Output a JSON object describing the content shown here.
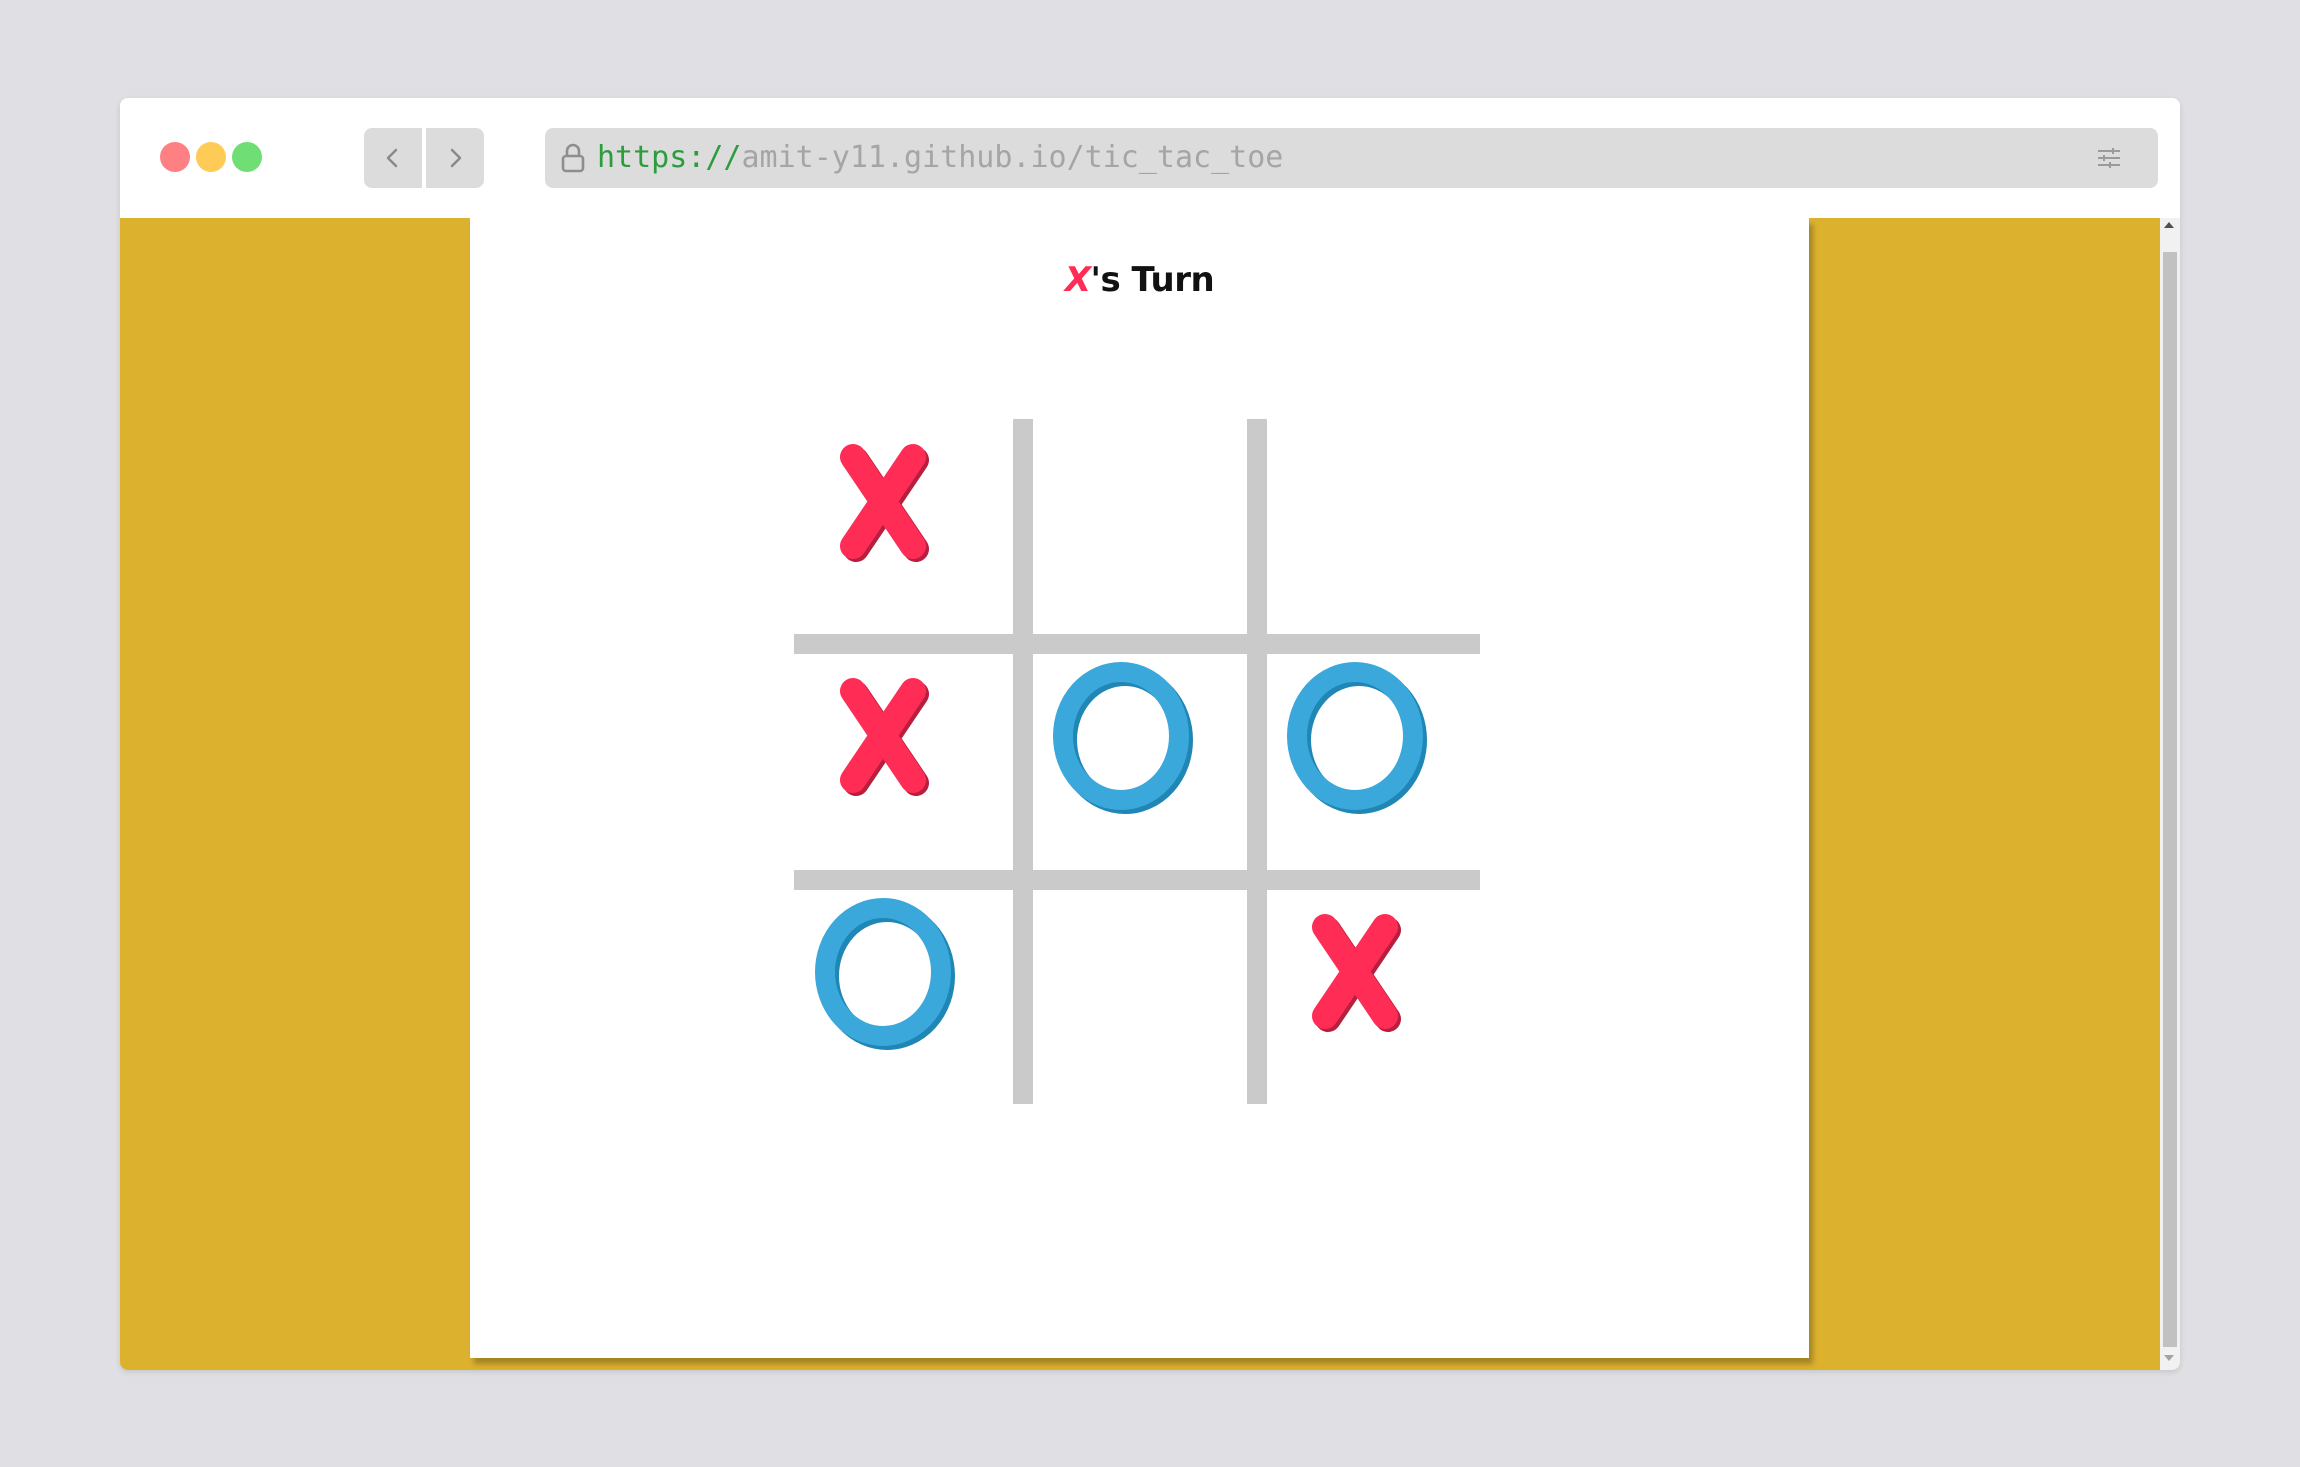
{
  "browser": {
    "url_scheme": "https://",
    "url_rest": "amit-y11.github.io/tic_tac_toe",
    "back_icon": "chevron-left-icon",
    "forward_icon": "chevron-right-icon",
    "lock_icon": "lock-icon",
    "menu_icon": "sliders-icon"
  },
  "game": {
    "turn_player": "X",
    "turn_text": "'s Turn",
    "board": [
      "X",
      "",
      "",
      "X",
      "O",
      "O",
      "O",
      "",
      "X"
    ],
    "colors": {
      "x": "#ff2d55",
      "o": "#3aa8da",
      "grid": "#cacaca",
      "background": "#dcb12e"
    }
  }
}
